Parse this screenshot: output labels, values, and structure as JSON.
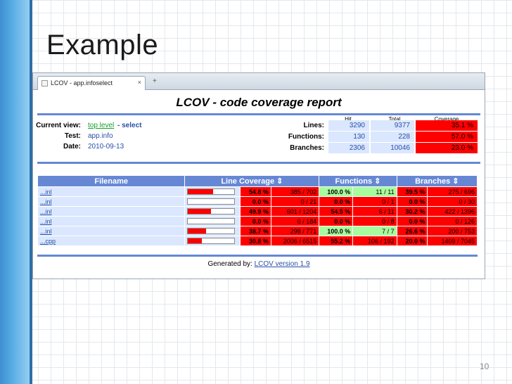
{
  "slide": {
    "title": "Example",
    "page_number": "10"
  },
  "browser": {
    "tab_title": "LCOV - app.infoselect",
    "tab_close": "×",
    "new_tab": "+"
  },
  "report": {
    "title": "LCOV - code coverage report",
    "current_view_label": "Current view:",
    "current_view_link": "top level",
    "current_view_rest": " - select",
    "test_label": "Test:",
    "test_value": "app.info",
    "date_label": "Date:",
    "date_value": "2010-09-13",
    "summary_headers": {
      "hit": "Hit",
      "total": "Total",
      "coverage": "Coverage"
    },
    "summary": [
      {
        "label": "Lines:",
        "hit": "3290",
        "total": "9377",
        "coverage": "35.1 %"
      },
      {
        "label": "Functions:",
        "hit": "130",
        "total": "228",
        "coverage": "57.0 %"
      },
      {
        "label": "Branches:",
        "hit": "2306",
        "total": "10046",
        "coverage": "23.0 %"
      }
    ],
    "table_headers": {
      "filename": "Filename",
      "line_coverage": "Line Coverage ⇕",
      "functions": "Functions ⇕",
      "branches": "Branches ⇕"
    },
    "rows": [
      {
        "filename": "...inl",
        "line_fill": 0.548,
        "line_pct": "54.8 %",
        "line_count": "385 / 702",
        "func_pct": "100.0 %",
        "func_count": "11 / 11",
        "func_ok": true,
        "branch_pct": "39.5 %",
        "branch_count": "275 / 696"
      },
      {
        "filename": "...inl",
        "line_fill": 0.0,
        "line_pct": "0.0 %",
        "line_count": "0 / 21",
        "func_pct": "0.0 %",
        "func_count": "0 / 1",
        "func_ok": false,
        "branch_pct": "0.0 %",
        "branch_count": "0 / 30"
      },
      {
        "filename": "...inl",
        "line_fill": 0.499,
        "line_pct": "49.9 %",
        "line_count": "601 / 1204",
        "func_pct": "54.5 %",
        "func_count": "6 / 11",
        "func_ok": false,
        "branch_pct": "30.2 %",
        "branch_count": "422 / 1396"
      },
      {
        "filename": "...inl",
        "line_fill": 0.0,
        "line_pct": "0.0 %",
        "line_count": "0 / 184",
        "func_pct": "0.0 %",
        "func_count": "0 / 8",
        "func_ok": false,
        "branch_pct": "0.0 %",
        "branch_count": "0 / 126"
      },
      {
        "filename": "...inl",
        "line_fill": 0.387,
        "line_pct": "38.7 %",
        "line_count": "298 / 771",
        "func_pct": "100.0 %",
        "func_count": "7 / 7",
        "func_ok": true,
        "branch_pct": "26.6 %",
        "branch_count": "200 / 753"
      },
      {
        "filename": "...cpp",
        "line_fill": 0.308,
        "line_pct": "30.8 %",
        "line_count": "2006 / 6515",
        "func_pct": "55.2 %",
        "func_count": "106 / 192",
        "func_ok": false,
        "branch_pct": "20.0 %",
        "branch_count": "1409 / 7045"
      }
    ],
    "footer_prefix": "Generated by: ",
    "footer_link": "LCOV version 1.9"
  }
}
